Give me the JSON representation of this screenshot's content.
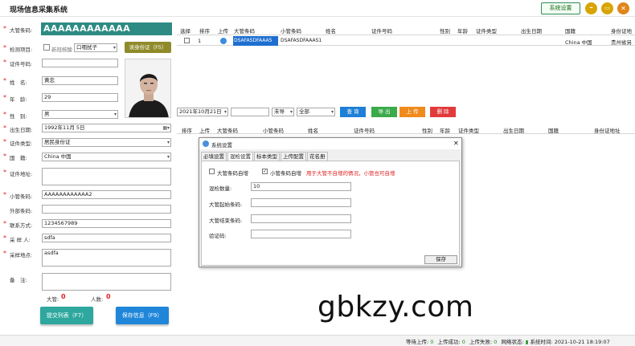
{
  "window": {
    "title": "现场信息采集系统",
    "settings_button": "系统设置",
    "controls": {
      "minimize": "–",
      "maximize": "▭",
      "close": "✕"
    }
  },
  "form": {
    "barcode_label": "大管条码:",
    "barcode_value": "AAAAAAAAAAAA",
    "test_item_label": "检测项目:",
    "test_item_checkbox": "新冠核酸",
    "test_item_select": "口咽拭子",
    "read_id_button": "读身份证（F5）",
    "id_number_label": "证件号码:",
    "id_number_value": "",
    "name_label": "姓　名:",
    "name_value": "黄忠",
    "age_label": "年　龄:",
    "age_value": "29",
    "gender_label": "性　别:",
    "gender_value": "男",
    "birth_label": "出生日期:",
    "birth_value": "1992年11月 5日",
    "id_type_label": "证件类型:",
    "id_type_value": "居民身份证",
    "nationality_label": "国　籍:",
    "nationality_value": "China 中国",
    "address_label": "证件地址:",
    "address_value": "",
    "small_barcode_label": "小管条码:",
    "small_barcode_value": "AAAAAAAAAAAA2",
    "ext_barcode_label": "外部条码:",
    "ext_barcode_value": "",
    "contact_label": "联系方式:",
    "contact_value": "1234567989",
    "collector_label": "采 样 人:",
    "collector_value": "sdfa",
    "site_label": "采样地点:",
    "site_value": "asdfa",
    "remark_label": "备　注:",
    "remark_value": "",
    "big_count_label": "大管:",
    "big_count_value": "0",
    "person_count_label": "人数:",
    "person_count_value": "0",
    "submit_list_button": "提交列表（F7）",
    "save_button": "保存信息（F9）"
  },
  "top_table": {
    "headers": [
      "选择",
      "排序",
      "上传",
      "大管条码",
      "小管条码",
      "姓名",
      "证件号码",
      "性别",
      "年龄",
      "证件类型",
      "出生日期",
      "国籍",
      "身份证地"
    ],
    "row": {
      "seq": "1",
      "big_barcode": "DSAFASDFAAAS",
      "small_barcode": "DSAFASDFAAAS1",
      "nationality": "China 中国",
      "address": "贵州省另"
    }
  },
  "toolbar": {
    "date": "2021年10月21日",
    "search_value": "",
    "upload_filter": "未导",
    "scope_filter": "全部",
    "query_button": "查 询",
    "export_button": "导 出",
    "upload_button": "上 传",
    "delete_button": "删 除"
  },
  "bottom_table": {
    "headers": [
      "排序",
      "上传",
      "大管条码",
      "小管条码",
      "姓名",
      "证件号码",
      "性别",
      "年龄",
      "证件类型",
      "出生日期",
      "国籍",
      "身份证地址"
    ]
  },
  "dialog": {
    "title": "系统设置",
    "close": "✕",
    "tabs": [
      "必填设置",
      "混检设置",
      "标本类型",
      "上传配置",
      "花名册"
    ],
    "big_self_barcode": "大管条码自增",
    "small_self_barcode": "小管条码自增",
    "hint": "用于大管不自增的情况，小管也可自增",
    "mix_count_label": "混检数量:",
    "mix_count_value": "10",
    "big_start_label": "大管起始条码:",
    "big_end_label": "大管结束条码:",
    "verify_label": "验证码:",
    "save_button": "保存"
  },
  "status": {
    "waiting_label": "等待上传:",
    "waiting_value": "0",
    "success_label": "上传成功:",
    "success_value": "0",
    "fail_label": "上传失败:",
    "fail_value": "0",
    "network_label": "网络状态:",
    "time_label": "系统时间:",
    "time_value": "2021-10-21 18:19:07"
  },
  "watermark": "gbkzy.com",
  "colors": {
    "teal": "#2e8b83",
    "query_blue": "#1f7fd6",
    "export_green": "#3aaa4a",
    "upload_orange": "#f08a1c",
    "delete_red": "#e23a3a",
    "accent_red": "#e02020"
  }
}
